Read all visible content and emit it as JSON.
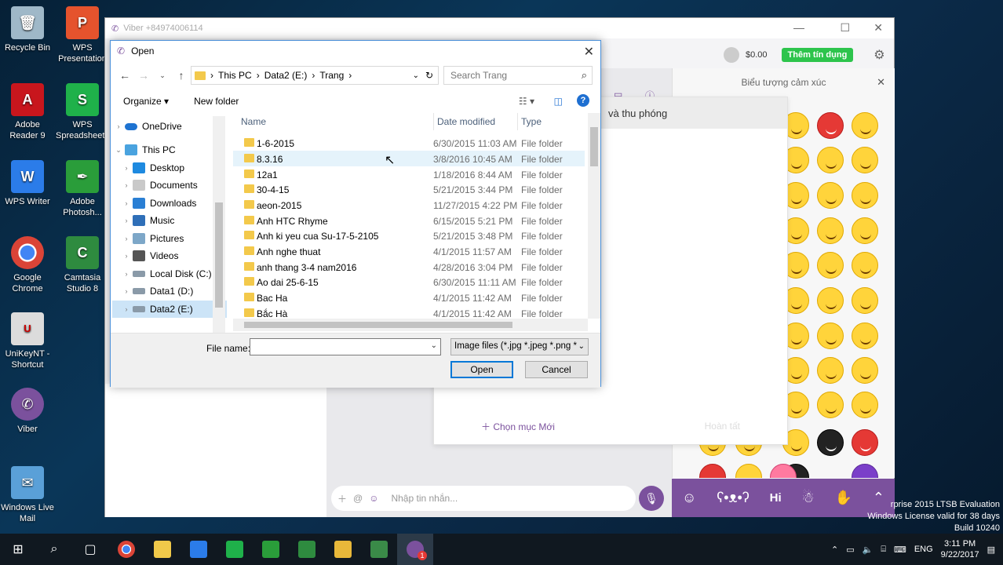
{
  "desktop": {
    "icons": [
      {
        "label": "Recycle Bin",
        "color": "#9fb8c8"
      },
      {
        "label": "WPS Presentation",
        "color": "#e5532d"
      },
      {
        "label": "Adobe Reader 9",
        "color": "#c8161d"
      },
      {
        "label": "WPS Spreadsheets",
        "color": "#1fb14a"
      },
      {
        "label": "WPS Writer",
        "color": "#2b7ce9"
      },
      {
        "label": "Adobe Photosh...",
        "color": "#2a9d3a"
      },
      {
        "label": "Google Chrome",
        "color": "#3b9a46"
      },
      {
        "label": "Camtasia Studio 8",
        "color": "#2e8b3f"
      },
      {
        "label": "UniKeyNT - Shortcut",
        "color": "#dcdcdc"
      },
      {
        "label": "Viber",
        "color": "#7b519d"
      },
      {
        "label": "Windows Live Mail",
        "color": "#5aa0d8"
      }
    ]
  },
  "viber": {
    "title": "Viber +84974006114",
    "balance": "$0.00",
    "add_credit": "Thêm tín dụng",
    "emoji_panel_title": "Biểu tượng cảm xúc",
    "card_title": "và thu phóng",
    "new_category": "Chọn mục Mới",
    "done": "Hoàn tất",
    "message_placeholder": "Nhập tin nhắn..."
  },
  "dialog": {
    "title": "Open",
    "breadcrumb": [
      "This PC",
      "Data2 (E:)",
      "Trang"
    ],
    "search_placeholder": "Search Trang",
    "organize": "Organize",
    "new_folder": "New folder",
    "nav_items": [
      {
        "label": "OneDrive",
        "icon": "onedrive-icon"
      },
      {
        "label": "This PC",
        "icon": "computer-icon"
      },
      {
        "label": "Desktop",
        "icon": "desktop-icon"
      },
      {
        "label": "Documents",
        "icon": "documents-icon"
      },
      {
        "label": "Downloads",
        "icon": "downloads-icon"
      },
      {
        "label": "Music",
        "icon": "music-icon"
      },
      {
        "label": "Pictures",
        "icon": "pictures-icon"
      },
      {
        "label": "Videos",
        "icon": "videos-icon"
      },
      {
        "label": "Local Disk (C:)",
        "icon": "drive-icon"
      },
      {
        "label": "Data1 (D:)",
        "icon": "drive-icon"
      },
      {
        "label": "Data2 (E:)",
        "icon": "drive-icon"
      }
    ],
    "columns": {
      "name": "Name",
      "date": "Date modified",
      "type": "Type"
    },
    "files": [
      {
        "name": "1-6-2015",
        "date": "6/30/2015 11:03 AM",
        "type": "File folder"
      },
      {
        "name": "8.3.16",
        "date": "3/8/2016 10:45 AM",
        "type": "File folder"
      },
      {
        "name": "12a1",
        "date": "1/18/2016 8:44 AM",
        "type": "File folder"
      },
      {
        "name": "30-4-15",
        "date": "5/21/2015 3:44 PM",
        "type": "File folder"
      },
      {
        "name": "aeon-2015",
        "date": "11/27/2015 4:22 PM",
        "type": "File folder"
      },
      {
        "name": "Anh HTC Rhyme",
        "date": "6/15/2015 5:21 PM",
        "type": "File folder"
      },
      {
        "name": "Anh ki yeu cua Su-17-5-2105",
        "date": "5/21/2015 3:48 PM",
        "type": "File folder"
      },
      {
        "name": "Anh nghe thuat",
        "date": "4/1/2015 11:57 AM",
        "type": "File folder"
      },
      {
        "name": "anh thang 3-4 nam2016",
        "date": "4/28/2016 3:04 PM",
        "type": "File folder"
      },
      {
        "name": "Ao dai 25-6-15",
        "date": "6/30/2015 11:11 AM",
        "type": "File folder"
      },
      {
        "name": "Bac Ha",
        "date": "4/1/2015 11:42 AM",
        "type": "File folder"
      },
      {
        "name": "Bắc Hà",
        "date": "4/1/2015 11:42 AM",
        "type": "File folder"
      }
    ],
    "file_name_label": "File name:",
    "file_name_value": "",
    "filter": "Image files (*.jpg *.jpeg *.png *",
    "open": "Open",
    "cancel": "Cancel"
  },
  "watermark": {
    "line1": "rprise 2015 LTSB Evaluation",
    "line2": "Windows License valid for 38 days",
    "line3": "Build 10240"
  },
  "taskbar": {
    "lang": "ENG",
    "time": "3:11 PM",
    "date": "9/22/2017",
    "viber_badge": "1"
  }
}
